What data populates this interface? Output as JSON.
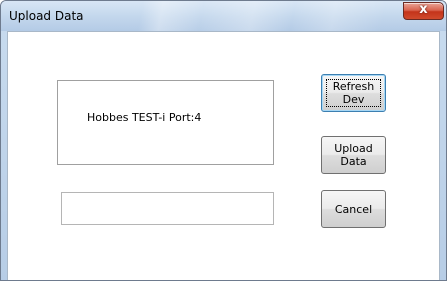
{
  "window": {
    "title": "Upload Data",
    "close_glyph": "x"
  },
  "device_info": {
    "text": "Hobbes TEST-i  Port:4"
  },
  "progress": {
    "value": ""
  },
  "buttons": {
    "refresh_label": "Refresh Dev",
    "upload_label": "Upload Data",
    "cancel_label": "Cancel"
  },
  "icons": {
    "close": "close-icon"
  }
}
